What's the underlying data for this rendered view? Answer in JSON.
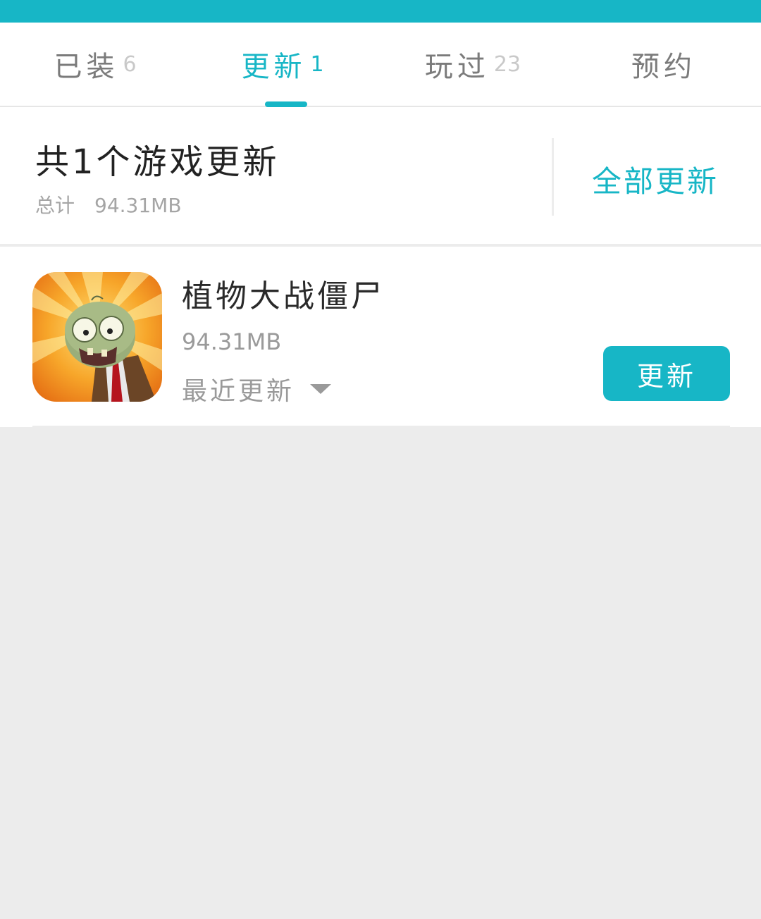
{
  "tabs": [
    {
      "label": "已装",
      "count": "6"
    },
    {
      "label": "更新",
      "count": "1"
    },
    {
      "label": "玩过",
      "count": "23"
    },
    {
      "label": "预约",
      "count": ""
    }
  ],
  "active_tab": "更新",
  "summary": {
    "title": "共1个游戏更新",
    "total_label": "总计",
    "total_size": "94.31MB",
    "update_all": "全部更新"
  },
  "games": [
    {
      "name": "植物大战僵尸",
      "size": "94.31MB",
      "recent_label": "最近更新",
      "action": "更新",
      "icon": "plants-vs-zombies-icon"
    }
  ],
  "colors": {
    "accent": "#17b6c6",
    "background": "#ececec",
    "text_primary": "#222222",
    "text_secondary": "#9a9a9a"
  }
}
